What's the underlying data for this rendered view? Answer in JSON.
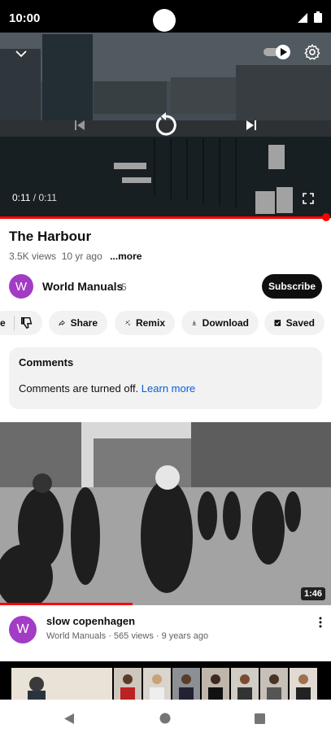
{
  "status_bar": {
    "time": "10:00"
  },
  "player": {
    "current_time": "0:11",
    "separator": " / ",
    "total_time": "0:11",
    "progress_fraction": 1.0
  },
  "video": {
    "title": "The Harbour",
    "views": "3.5K views",
    "age": "10 yr ago",
    "more_label": "...more"
  },
  "channel": {
    "avatar_letter": "W",
    "name": "World Manuals",
    "subscriber_count": "5",
    "subscribe_label": "Subscribe"
  },
  "actions": {
    "like_partial": "e",
    "share": "Share",
    "remix": "Remix",
    "download": "Download",
    "saved": "Saved"
  },
  "comments": {
    "heading": "Comments",
    "text": "Comments are turned off.",
    "link": "Learn more"
  },
  "recommended": {
    "duration": "1:46",
    "watched_fraction": 0.4,
    "avatar_letter": "W",
    "title": "slow copenhagen",
    "meta": "World Manuals · 565 views · 9 years ago"
  },
  "colors": {
    "accent": "#ff0000",
    "avatar": "#a33cc4",
    "link": "#065fd4"
  }
}
